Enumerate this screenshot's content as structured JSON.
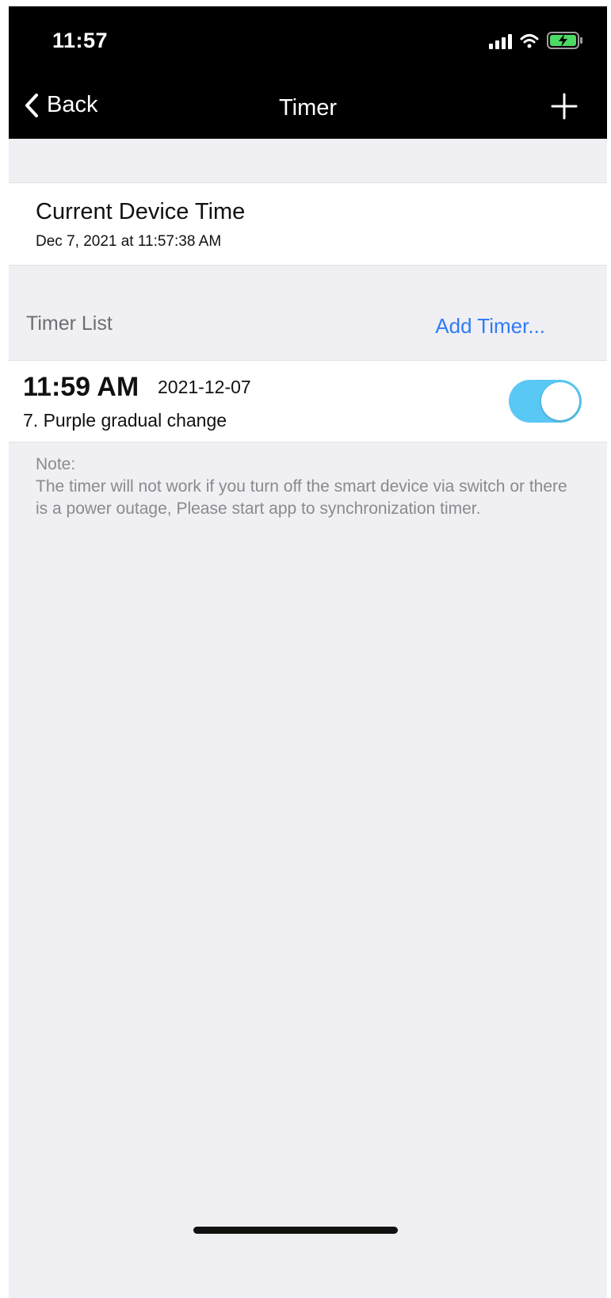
{
  "status_bar": {
    "time": "11:57",
    "icons": [
      "signal-icon",
      "wifi-icon",
      "battery-charging-icon"
    ],
    "battery_color": "#4cd964"
  },
  "nav": {
    "back_label": "Back",
    "title": "Timer",
    "add_icon": "plus-icon"
  },
  "device_time": {
    "title": "Current Device Time",
    "value": "Dec 7, 2021 at 11:57:38 AM"
  },
  "timer_list": {
    "label": "Timer List",
    "add_label": "Add Timer...",
    "items": [
      {
        "time": "11:59 AM",
        "date": "2021-12-07",
        "description": "7. Purple gradual change",
        "enabled": true
      }
    ]
  },
  "note": {
    "text": "Note:\nThe timer will not work if you turn off the smart device via switch or there is a power outage, Please start app to synchronization timer."
  },
  "colors": {
    "accent": "#2f7cf6",
    "toggle_on": "#5ac8f5",
    "background": "#efeff4"
  }
}
